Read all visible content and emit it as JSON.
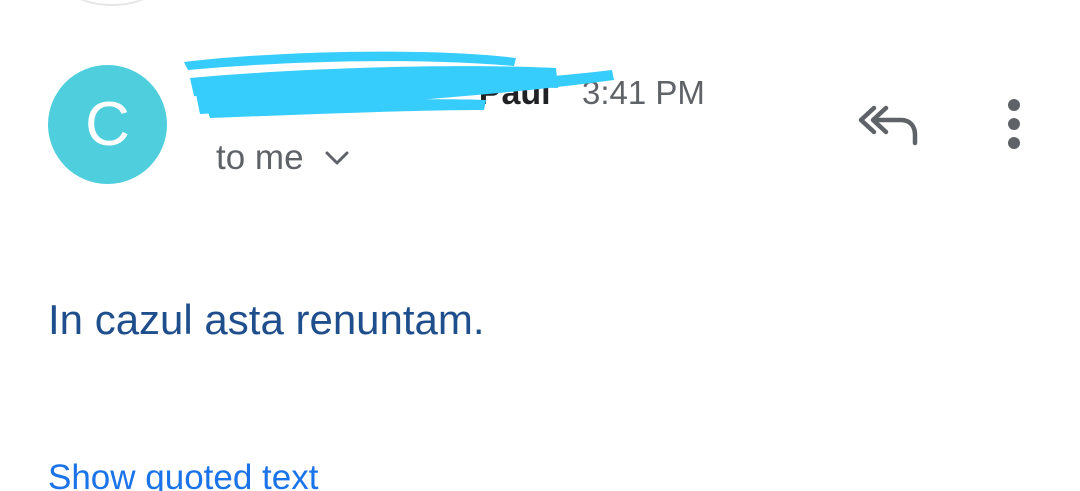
{
  "email": {
    "avatar_letter": "C",
    "sender_name": "C                                   Paul",
    "time": "3:41 PM",
    "recipient": "to me",
    "body": "In cazul asta renuntam.",
    "show_quoted": "Show quoted text"
  },
  "icons": {
    "reply_all": "reply-all-icon",
    "more": "more-vert-icon",
    "details": "chevron-down-icon"
  },
  "colors": {
    "avatar_bg": "#4fcfdd",
    "redaction": "#36ccfb",
    "body_text": "#1f4e8c",
    "link": "#1a73e8",
    "icon": "#5f6368"
  }
}
